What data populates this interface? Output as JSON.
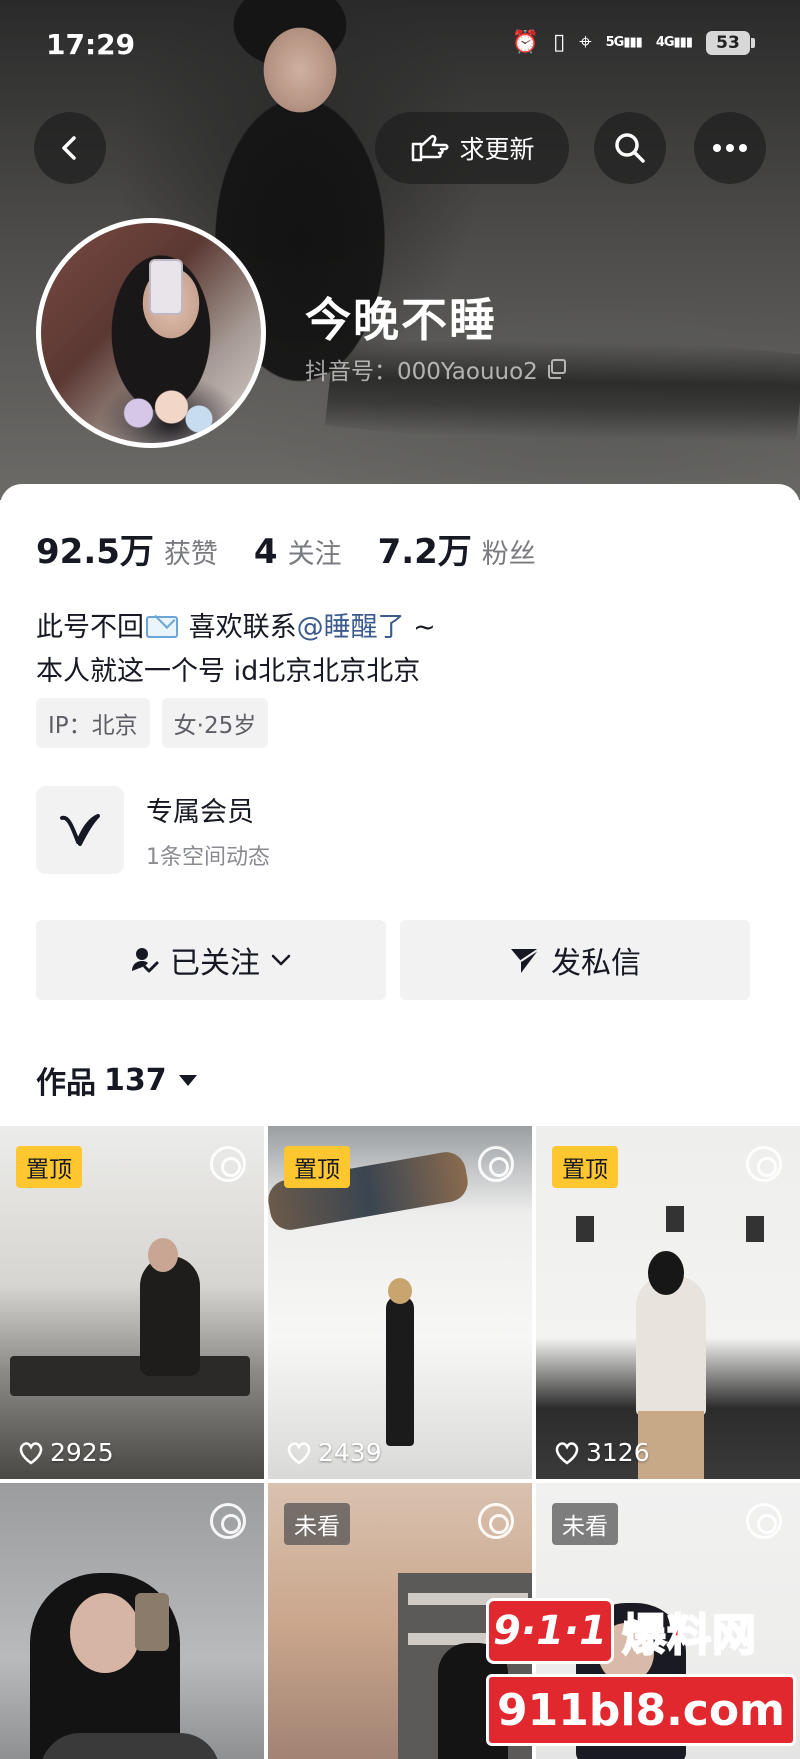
{
  "status_bar": {
    "time": "17:29",
    "signal_5g": "5G",
    "signal_4g": "4G",
    "battery": "53"
  },
  "header": {
    "request_update_label": "求更新",
    "profile_name": "今晚不睡",
    "douyin_id": "抖音号：000Yaouuo2"
  },
  "stats": [
    {
      "value": "92.5万",
      "label": "获赞"
    },
    {
      "value": "4",
      "label": "关注"
    },
    {
      "value": "7.2万",
      "label": "粉丝"
    }
  ],
  "bio": {
    "line1_prefix": "此号不回",
    "line1_middle": " 喜欢联系",
    "line1_mention": "@睡醒了",
    "line1_suffix": " ~",
    "line2": "本人就这一个号  id北京北京北京"
  },
  "tags": [
    "IP：北京",
    "女·25岁"
  ],
  "member": {
    "title": "专属会员",
    "subtitle": "1条空间动态"
  },
  "actions": {
    "follow_label": "已关注",
    "message_label": "发私信"
  },
  "works": {
    "label": "作品",
    "count": "137"
  },
  "tiles": [
    {
      "badge": "置顶",
      "badge_type": "pin",
      "likes": "2925"
    },
    {
      "badge": "置顶",
      "badge_type": "pin",
      "likes": "2439"
    },
    {
      "badge": "置顶",
      "badge_type": "pin",
      "likes": "3126"
    },
    {
      "badge": "",
      "badge_type": "none",
      "likes": ""
    },
    {
      "badge": "未看",
      "badge_type": "unseen",
      "likes": ""
    },
    {
      "badge": "未看",
      "badge_type": "unseen",
      "likes": ""
    }
  ],
  "watermark": {
    "badge": "9·1·1",
    "text": "爆料网",
    "url": "911bl8.com"
  },
  "colors": {
    "accent_pin": "#fec62f",
    "mention": "#3b5b8c",
    "watermark_red": "#e0282e"
  },
  "icons": [
    "back-icon",
    "hand-point-icon",
    "search-icon",
    "more-icon",
    "copy-icon",
    "user-check-icon",
    "chevron-down-icon",
    "send-icon",
    "vip-v-icon",
    "live-photo-icon",
    "heart-icon",
    "mail-emoji-icon"
  ]
}
